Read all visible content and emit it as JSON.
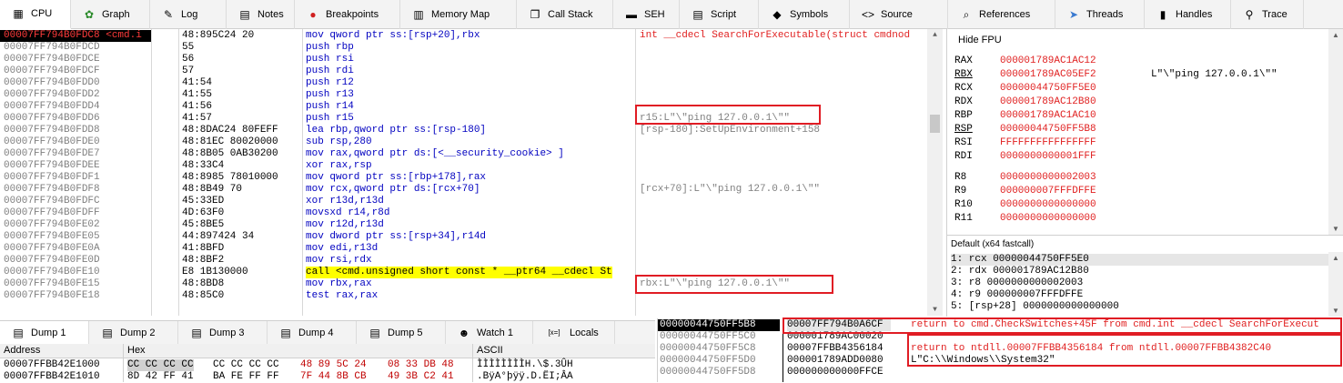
{
  "tabs": [
    {
      "label": "CPU",
      "icon": "cpu-icon",
      "glyph": "▦"
    },
    {
      "label": "Graph",
      "icon": "graph-icon",
      "glyph": "✿"
    },
    {
      "label": "Log",
      "icon": "log-icon",
      "glyph": "✎"
    },
    {
      "label": "Notes",
      "icon": "notes-icon",
      "glyph": "▤"
    },
    {
      "label": "Breakpoints",
      "icon": "breakpoint-icon",
      "glyph": "●"
    },
    {
      "label": "Memory Map",
      "icon": "memory-map-icon",
      "glyph": "▥"
    },
    {
      "label": "Call Stack",
      "icon": "call-stack-icon",
      "glyph": "❐"
    },
    {
      "label": "SEH",
      "icon": "seh-icon",
      "glyph": "▬"
    },
    {
      "label": "Script",
      "icon": "script-icon",
      "glyph": "▤"
    },
    {
      "label": "Symbols",
      "icon": "symbols-icon",
      "glyph": "◆"
    },
    {
      "label": "Source",
      "icon": "source-icon",
      "glyph": "<>"
    },
    {
      "label": "References",
      "icon": "references-icon",
      "glyph": "⌕"
    },
    {
      "label": "Threads",
      "icon": "threads-icon",
      "glyph": "➤"
    },
    {
      "label": "Handles",
      "icon": "handles-icon",
      "glyph": "▮"
    },
    {
      "label": "Trace",
      "icon": "trace-icon",
      "glyph": "⚲"
    }
  ],
  "disasm": [
    {
      "addr": "00007FF794B0FDC8 <cmd.i",
      "bytes": "48:895C24 20",
      "inst": "mov  qword ptr  ss:[rsp+20],rbx",
      "cmt": "int __cdecl SearchForExecutable(struct cmdnod",
      "sel": true,
      "cmt_red": true
    },
    {
      "addr": "00007FF794B0FDCD",
      "bytes": "55",
      "inst": "push rbp",
      "cmt": ""
    },
    {
      "addr": "00007FF794B0FDCE",
      "bytes": "56",
      "inst": "push rsi",
      "cmt": ""
    },
    {
      "addr": "00007FF794B0FDCF",
      "bytes": "57",
      "inst": "push rdi",
      "cmt": ""
    },
    {
      "addr": "00007FF794B0FDD0",
      "bytes": "41:54",
      "inst": "push r12",
      "cmt": ""
    },
    {
      "addr": "00007FF794B0FDD2",
      "bytes": "41:55",
      "inst": "push r13",
      "cmt": ""
    },
    {
      "addr": "00007FF794B0FDD4",
      "bytes": "41:56",
      "inst": "push r14",
      "cmt": ""
    },
    {
      "addr": "00007FF794B0FDD6",
      "bytes": "41:57",
      "inst": "push r15",
      "cmt": "r15:L\"\\\"ping 127.0.0.1\\\"\""
    },
    {
      "addr": "00007FF794B0FDD8",
      "bytes": "48:8DAC24 80FEFF",
      "inst": "lea rbp,qword ptr  ss:[rsp-180]",
      "cmt": "[rsp-180]:SetUpEnvironment+158"
    },
    {
      "addr": "00007FF794B0FDE0",
      "bytes": "48:81EC 80020000",
      "inst": "sub rsp,280",
      "cmt": ""
    },
    {
      "addr": "00007FF794B0FDE7",
      "bytes": "48:8B05 0AB30200",
      "inst": "mov rax,qword ptr  ds:[<__security_cookie>  ]",
      "cmt": ""
    },
    {
      "addr": "00007FF794B0FDEE",
      "bytes": "48:33C4",
      "inst": "xor rax,rsp",
      "cmt": ""
    },
    {
      "addr": "00007FF794B0FDF1",
      "bytes": "48:8985 78010000",
      "inst": "mov qword ptr  ss:[rbp+178],rax",
      "cmt": ""
    },
    {
      "addr": "00007FF794B0FDF8",
      "bytes": "48:8B49 70",
      "inst": "mov rcx,qword ptr  ds:[rcx+70]",
      "cmt": "[rcx+70]:L\"\\\"ping 127.0.0.1\\\"\""
    },
    {
      "addr": "00007FF794B0FDFC",
      "bytes": "45:33ED",
      "inst": "xor r13d,r13d",
      "cmt": ""
    },
    {
      "addr": "00007FF794B0FDFF",
      "bytes": "4D:63F0",
      "inst": "movsxd  r14,r8d",
      "cmt": ""
    },
    {
      "addr": "00007FF794B0FE02",
      "bytes": "45:8BE5",
      "inst": "mov r12d,r13d",
      "cmt": ""
    },
    {
      "addr": "00007FF794B0FE05",
      "bytes": "44:897424 34",
      "inst": "mov dword ptr  ss:[rsp+34],r14d",
      "cmt": ""
    },
    {
      "addr": "00007FF794B0FE0A",
      "bytes": "41:8BFD",
      "inst": "mov edi,r13d",
      "cmt": ""
    },
    {
      "addr": "00007FF794B0FE0D",
      "bytes": "48:8BF2",
      "inst": "mov rsi,rdx",
      "cmt": ""
    },
    {
      "addr": "00007FF794B0FE10",
      "bytes": "E8 1B130000",
      "inst": "call  <cmd.unsigned short const * __ptr64 __cdecl St",
      "cmt": ""
    },
    {
      "addr": "00007FF794B0FE15",
      "bytes": "48:8BD8",
      "inst": "mov rbx,rax",
      "cmt": "rbx:L\"\\\"ping 127.0.0.1\\\"\""
    },
    {
      "addr": "00007FF794B0FE18",
      "bytes": "48:85C0",
      "inst": "test rax,rax",
      "cmt": ""
    }
  ],
  "registers_header": "Hide FPU",
  "registers": [
    {
      "name": "RAX",
      "val": "000001789AC1AC12",
      "cmt": "",
      "u": false
    },
    {
      "name": "RBX",
      "val": "000001789AC05EF2",
      "cmt": "L\"\\\"ping 127.0.0.1\\\"\"",
      "u": true
    },
    {
      "name": "RCX",
      "val": "00000044750FF5E0",
      "cmt": "",
      "u": false
    },
    {
      "name": "RDX",
      "val": "000001789AC12B80",
      "cmt": "",
      "u": false
    },
    {
      "name": "RBP",
      "val": "000001789AC1AC10",
      "cmt": "",
      "u": false
    },
    {
      "name": "RSP",
      "val": "00000044750FF5B8",
      "cmt": "",
      "u": true
    },
    {
      "name": "RSI",
      "val": "FFFFFFFFFFFFFFFF",
      "cmt": "",
      "u": false
    },
    {
      "name": "RDI",
      "val": "0000000000001FFF",
      "cmt": "",
      "u": false
    },
    {
      "name": "R8",
      "val": "0000000000002003",
      "cmt": "",
      "u": false
    },
    {
      "name": "R9",
      "val": "000000007FFFDFFE",
      "cmt": "",
      "u": false
    },
    {
      "name": "R10",
      "val": "0000000000000000",
      "cmt": "",
      "u": false
    },
    {
      "name": "R11",
      "val": "0000000000000000",
      "cmt": "",
      "u": false
    }
  ],
  "calling_convention": "Default (x64 fastcall)",
  "args": [
    "1: rcx 00000044750FF5E0",
    "2: rdx 000001789AC12B80",
    "3: r8 0000000000002003",
    "4: r9 000000007FFFDFFE",
    "5: [rsp+28] 0000000000000000"
  ],
  "dump_tabs": [
    {
      "label": "Dump 1",
      "icon": "dump-icon",
      "glyph": "▤"
    },
    {
      "label": "Dump 2",
      "icon": "dump-icon",
      "glyph": "▤"
    },
    {
      "label": "Dump 3",
      "icon": "dump-icon",
      "glyph": "▤"
    },
    {
      "label": "Dump 4",
      "icon": "dump-icon",
      "glyph": "▤"
    },
    {
      "label": "Dump 5",
      "icon": "dump-icon",
      "glyph": "▤"
    },
    {
      "label": "Watch 1",
      "icon": "watch-icon",
      "glyph": "☻"
    },
    {
      "label": "Locals",
      "icon": "locals-icon",
      "glyph": "[x=]"
    }
  ],
  "dump_headers": {
    "address": "Address",
    "hex": "Hex",
    "ascii": "ASCII"
  },
  "dump_rows": [
    {
      "addr": "00007FFBB42E1000",
      "hex1": "CC CC CC CC",
      "hex2": "CC CC CC CC",
      "hex3": "48 89 5C 24",
      "hex4": "08 33 DB 48",
      "ascii": "ÌÌÌÌÌÌÌÌH.\\$.3ÛH"
    },
    {
      "addr": "00007FFBB42E1010",
      "hex1": "8D 42 FF 41",
      "hex2": "BA FE FF FF",
      "hex3": "7F 44 8B CB",
      "hex4": "49 3B C2 41",
      "ascii": ".BÿA°þÿÿ.D.ËI;ÂA"
    }
  ],
  "stack": [
    {
      "addr": "00000044750FF5B8",
      "val": "00007FF794B0A6CF",
      "cmt": "return to cmd.CheckSwitches+45F from cmd.int __cdecl SearchForExecut",
      "sel": true
    },
    {
      "addr": "00000044750FF5C0",
      "val": "000001789AC00020",
      "cmt": ""
    },
    {
      "addr": "00000044750FF5C8",
      "val": "00007FFBB4356184",
      "cmt": "return to ntdll.00007FFBB4356184 from ntdll.00007FFBB4382C40"
    },
    {
      "addr": "00000044750FF5D0",
      "val": "000001789ADD0080",
      "cmt": "L\"C:\\\\Windows\\\\System32\"",
      "black": true
    },
    {
      "addr": "00000044750FF5D8",
      "val": "000000000000FFCE",
      "cmt": ""
    }
  ],
  "colors": {
    "accent_red": "#e01c24",
    "comment_red": "#e02020",
    "highlight_yellow": "#ffff00",
    "addr_gray": "#808080"
  }
}
